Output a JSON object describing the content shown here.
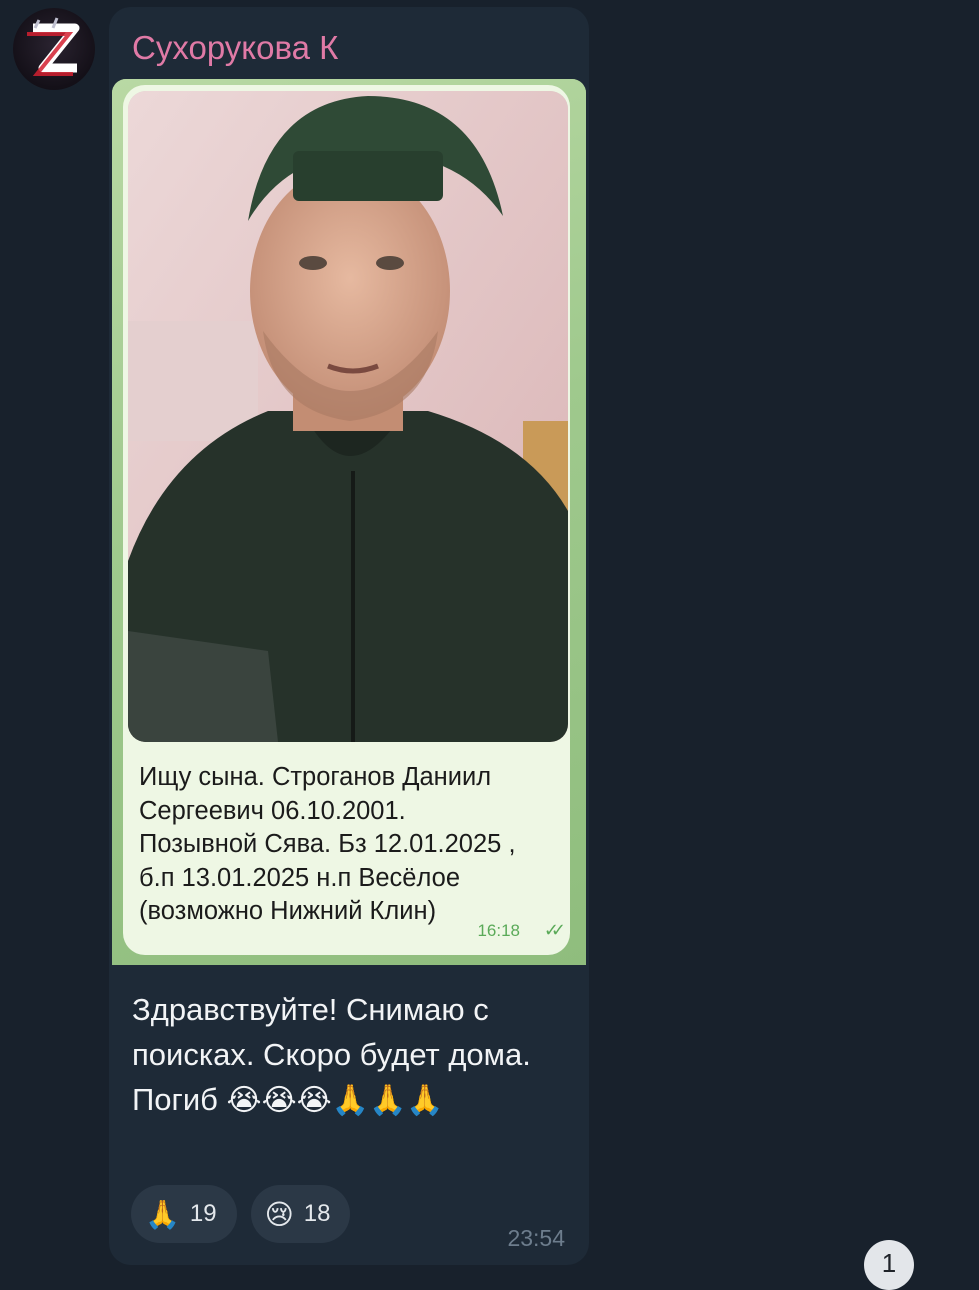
{
  "sender": {
    "name": "Сухорукова К",
    "name_color": "#e07aa6",
    "avatar_icon": "z-logo-icon"
  },
  "forwarded_message": {
    "text": "Ищу сына. Строганов Даниил\nСергеевич 06.10.2001.\nПозывной Сява. Бз 12.01.2025 ,\nб.п 13.01.2025 н.п Весёлое\n(возможно Нижний Клин)",
    "time": "16:18",
    "status_icon": "double-check-icon"
  },
  "message": {
    "text": "Здравствуйте! Снимаю с поисках. Скоро будет дома. Погиб",
    "emojis": "😭😭😭🙏🙏🙏",
    "time": "23:54"
  },
  "reactions": [
    {
      "emoji": "🙏",
      "count": "19"
    },
    {
      "emoji": "😢",
      "count": "18"
    }
  ],
  "unread_badge": "1",
  "colors": {
    "background": "#18212c",
    "bubble": "#1e2a37",
    "accent_green": "#5aaa58"
  }
}
